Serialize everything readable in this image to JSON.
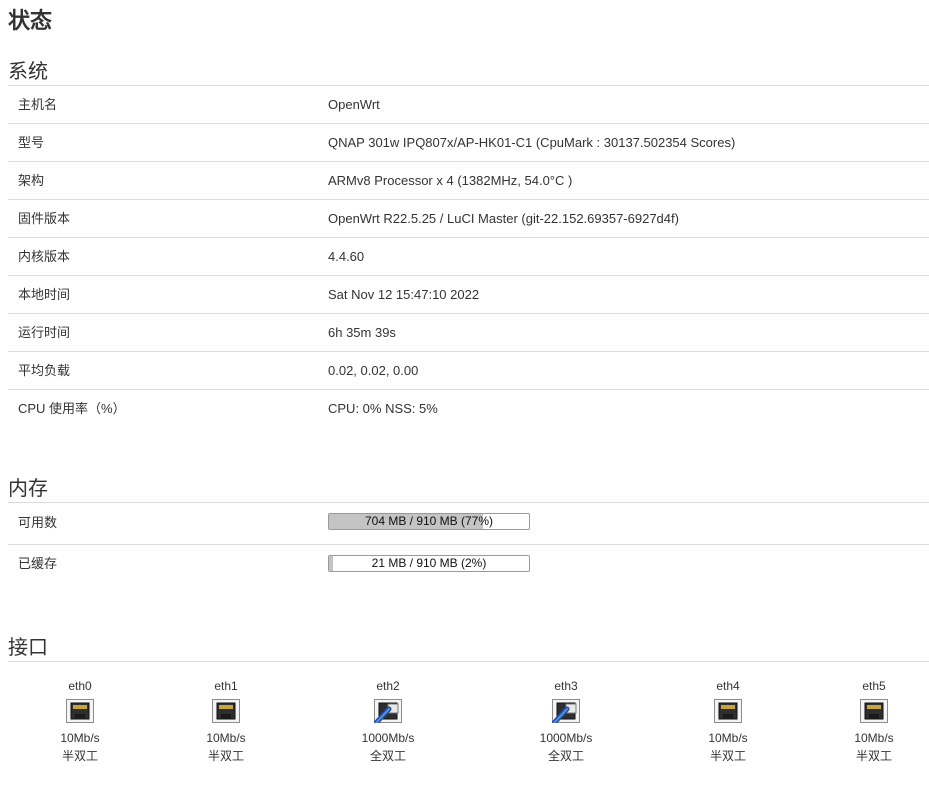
{
  "page": {
    "title": "状态"
  },
  "system": {
    "title": "系统",
    "rows": [
      {
        "label": "主机名",
        "value": "OpenWrt"
      },
      {
        "label": "型号",
        "value": "QNAP 301w IPQ807x/AP-HK01-C1 (CpuMark : 30137.502354 Scores)"
      },
      {
        "label": "架构",
        "value": "ARMv8 Processor x 4 (1382MHz, 54.0°C )"
      },
      {
        "label": "固件版本",
        "value": "OpenWrt R22.5.25 / LuCI Master (git-22.152.69357-6927d4f)"
      },
      {
        "label": "内核版本",
        "value": "4.4.60"
      },
      {
        "label": "本地时间",
        "value": "Sat Nov 12 15:47:10 2022"
      },
      {
        "label": "运行时间",
        "value": "6h 35m 39s"
      },
      {
        "label": "平均负载",
        "value": "0.02, 0.02, 0.00"
      },
      {
        "label": "CPU 使用率（%）",
        "value": "CPU: 0% NSS: 5%"
      }
    ]
  },
  "memory": {
    "title": "内存",
    "rows": [
      {
        "label": "可用数",
        "bar_text": "704 MB / 910 MB (77%)",
        "percent": 77
      },
      {
        "label": "已缓存",
        "bar_text": "21 MB / 910 MB (2%)",
        "percent": 2
      }
    ]
  },
  "interfaces": {
    "title": "接口",
    "ports": [
      {
        "name": "eth0",
        "speed": "10Mb/s",
        "duplex": "半双工",
        "icon": "ethernet-port-disconnected-icon",
        "connected": false
      },
      {
        "name": "eth1",
        "speed": "10Mb/s",
        "duplex": "半双工",
        "icon": "ethernet-port-disconnected-icon",
        "connected": false
      },
      {
        "name": "eth2",
        "speed": "1000Mb/s",
        "duplex": "全双工",
        "icon": "ethernet-port-connected-icon",
        "connected": true
      },
      {
        "name": "eth3",
        "speed": "1000Mb/s",
        "duplex": "全双工",
        "icon": "ethernet-port-connected-icon",
        "connected": true
      },
      {
        "name": "eth4",
        "speed": "10Mb/s",
        "duplex": "半双工",
        "icon": "ethernet-port-disconnected-icon",
        "connected": false
      },
      {
        "name": "eth5",
        "speed": "10Mb/s",
        "duplex": "半双工",
        "icon": "ethernet-port-disconnected-icon",
        "connected": false
      }
    ]
  }
}
